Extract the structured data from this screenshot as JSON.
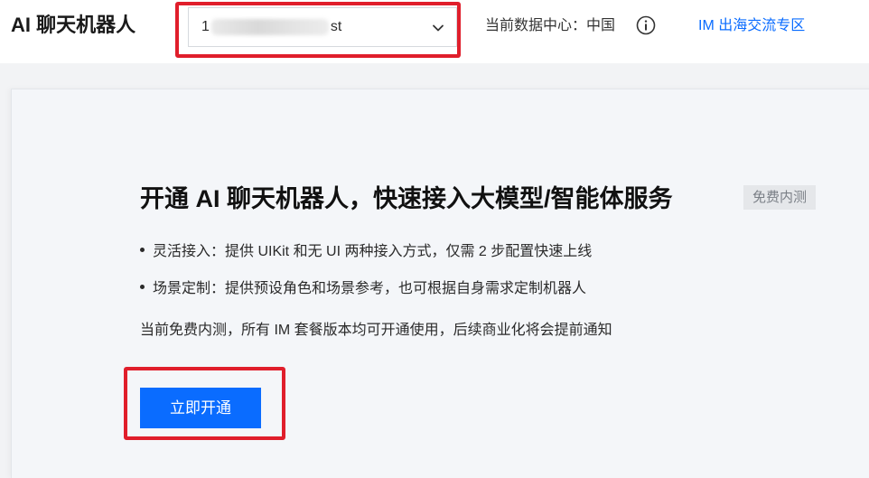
{
  "header": {
    "title": "AI 聊天机器人",
    "app_select": {
      "value_prefix": "1",
      "value_suffix": "st",
      "icon": "chevron-down-icon"
    },
    "data_center_label": "当前数据中心：中国",
    "info_icon": "info-icon",
    "im_link": "IM 出海交流专区"
  },
  "main": {
    "headline": "开通 AI 聊天机器人，快速接入大模型/智能体服务",
    "badge": "免费内测",
    "bullets": [
      "灵活接入：提供 UIKit 和无 UI 两种接入方式，仅需 2 步配置快速上线",
      "场景定制：提供预设角色和场景参考，也可根据自身需求定制机器人"
    ],
    "notice": "当前免费内测，所有 IM 套餐版本均可开通使用，后续商业化将会提前通知",
    "activate_button": "立即开通"
  },
  "colors": {
    "accent": "#0a6cff",
    "highlight": "#e01e2b",
    "badge_bg": "#e5e7ea"
  }
}
